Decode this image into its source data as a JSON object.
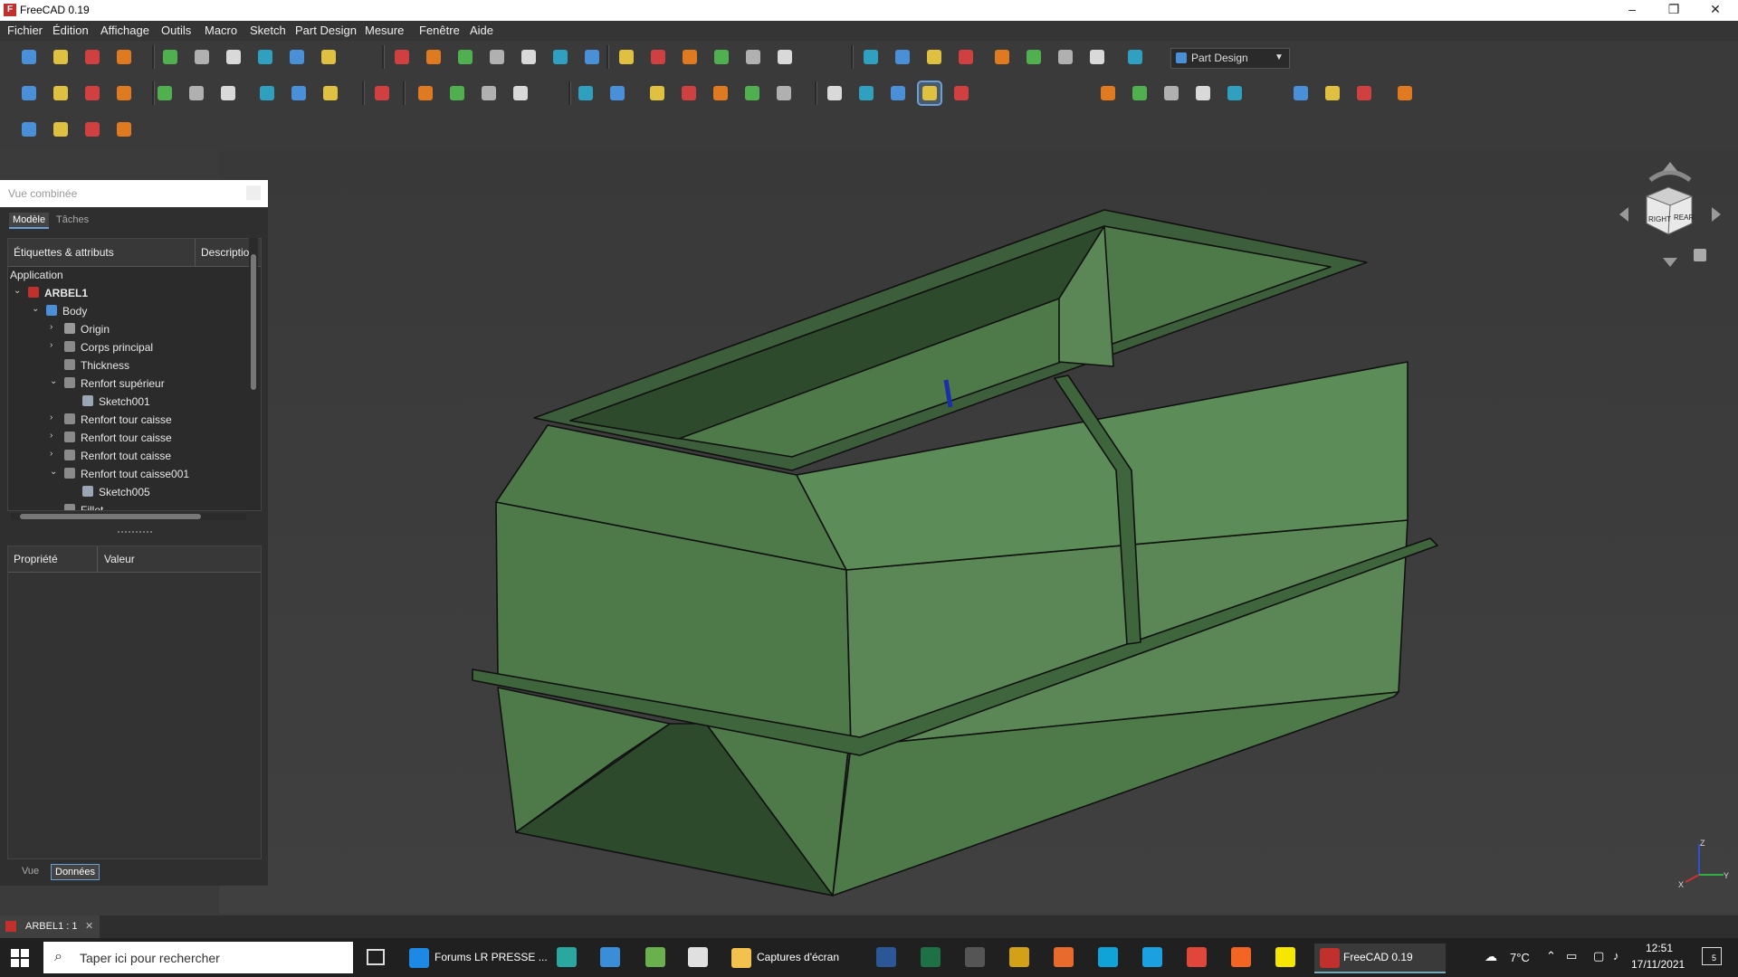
{
  "window": {
    "title": "FreeCAD 0.19",
    "logo": "F"
  },
  "window_controls": [
    "–",
    "❐",
    "✕"
  ],
  "menu": [
    "Fichier",
    "Édition",
    "Affichage",
    "Outils",
    "Macro",
    "Sketch",
    "Part Design",
    "Mesure",
    "Fenêtre",
    "Aide"
  ],
  "workbench": {
    "selected": "Part Design"
  },
  "combo": {
    "title": "Vue combinée",
    "tabs": [
      "Modèle",
      "Tâches"
    ],
    "tree_headers": [
      "Étiquettes & attributs",
      "Descriptio"
    ],
    "tree": [
      {
        "label": "Application",
        "depth": 0,
        "arrow": "",
        "icon": "none",
        "bold": false
      },
      {
        "label": "ARBEL1",
        "depth": 0,
        "arrow": "down",
        "icon": "document-icon",
        "bold": true
      },
      {
        "label": "Body",
        "depth": 1,
        "arrow": "down",
        "icon": "body-icon",
        "bold": false
      },
      {
        "label": "Origin",
        "depth": 2,
        "arrow": "right",
        "icon": "origin-icon",
        "bold": false
      },
      {
        "label": "Corps principal",
        "depth": 2,
        "arrow": "right",
        "icon": "feature-icon",
        "bold": false
      },
      {
        "label": "Thickness",
        "depth": 2,
        "arrow": "",
        "icon": "feature-icon",
        "bold": false
      },
      {
        "label": "Renfort supérieur",
        "depth": 2,
        "arrow": "down",
        "icon": "feature-icon",
        "bold": false
      },
      {
        "label": "Sketch001",
        "depth": 3,
        "arrow": "",
        "icon": "sketch-icon",
        "bold": false
      },
      {
        "label": "Renfort tour caisse",
        "depth": 2,
        "arrow": "right",
        "icon": "feature-icon",
        "bold": false
      },
      {
        "label": "Renfort tour caisse",
        "depth": 2,
        "arrow": "right",
        "icon": "feature-icon",
        "bold": false
      },
      {
        "label": "Renfort tout caisse",
        "depth": 2,
        "arrow": "right",
        "icon": "feature-icon",
        "bold": false
      },
      {
        "label": "Renfort tout caisse001",
        "depth": 2,
        "arrow": "down",
        "icon": "feature-icon",
        "bold": false
      },
      {
        "label": "Sketch005",
        "depth": 3,
        "arrow": "",
        "icon": "sketch-icon",
        "bold": false
      },
      {
        "label": "Fillet",
        "depth": 2,
        "arrow": "",
        "icon": "feature-icon",
        "bold": false
      }
    ],
    "props_headers": [
      "Propriété",
      "Valeur"
    ],
    "bottom_tabs": [
      "Vue",
      "Données"
    ]
  },
  "navcube": {
    "faces": [
      "RIGHT",
      "REAR"
    ]
  },
  "axis": {
    "x": "X",
    "y": "Y",
    "z": "Z"
  },
  "document_tab": {
    "label": "ARBEL1 : 1",
    "close": "✕"
  },
  "taskbar": {
    "search_placeholder": "Taper ici pour rechercher",
    "apps": [
      {
        "label": "Forums LR PRESSE ...",
        "icon": "edge-icon",
        "color": "#1e88e5"
      },
      {
        "label": "Captures d'écran",
        "icon": "folder-icon",
        "color": "#f2c14e"
      },
      {
        "label": "FreeCAD 0.19",
        "icon": "freecad-icon",
        "color": "#c0302c"
      }
    ],
    "weather": "7°C",
    "time": "12:51",
    "date": "17/11/2021",
    "notifications": "5"
  },
  "colors": {
    "model_face": "#4e7a4a",
    "model_face_light": "#5c8c57",
    "model_face_dark": "#2e4a2c",
    "accent": "#6a9fd8"
  }
}
